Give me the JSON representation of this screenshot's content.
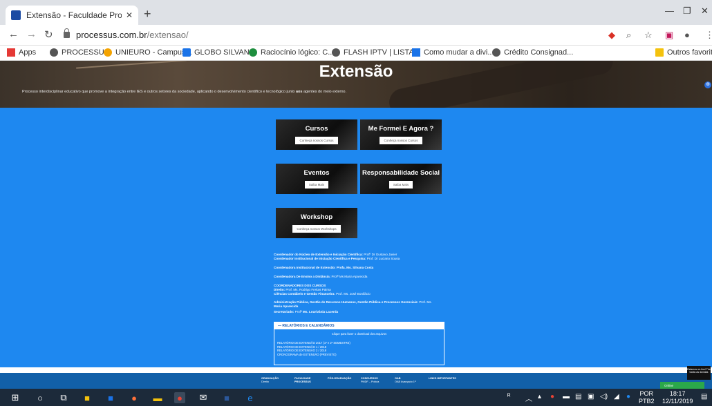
{
  "browser": {
    "tab_title": "Extensão - Faculdade Processus |",
    "tab_close": "✕",
    "new_tab": "+",
    "url_host": "processus.com.br",
    "url_path": "/extensao/",
    "bookmarks": [
      {
        "label": "Apps",
        "color": "#e53935"
      },
      {
        "label": "PROCESSUS",
        "color": "#555555"
      },
      {
        "label": "UNIEURO - Campus...",
        "color": "#f4a300"
      },
      {
        "label": "GLOBO SILVANA",
        "color": "#1a73e8"
      },
      {
        "label": "Raciocínio lógico: C...",
        "color": "#1e8e3e"
      },
      {
        "label": "FLASH IPTV | LISTA...",
        "color": "#555555"
      },
      {
        "label": "Como mudar a divi...",
        "color": "#1a73e8"
      },
      {
        "label": "Crédito Consignad...",
        "color": "#555555"
      },
      {
        "label": "Outros favoritos",
        "color": "#f4c20d"
      }
    ]
  },
  "hero": {
    "title": "Extensão",
    "description_start": "Processo interdisciplinar educativo que promove a integração entre IES e outros setores da sociedade, aplicando o desenvolvimento científico e tecnológico junto ",
    "description_bold": "aos",
    "description_end": " agentes do meio externo."
  },
  "cards": [
    {
      "title": "Cursos",
      "button": "Conheça nossos Cursos"
    },
    {
      "title": "Me Formei E Agora ?",
      "button": "Conheça nossos Cursos"
    },
    {
      "title": "Eventos",
      "button": "Saiba Mais"
    },
    {
      "title": "Responsabilidade Social",
      "button": "Saiba Mais"
    },
    {
      "title": "Workshop",
      "button": "Conheça nossos Workshops"
    }
  ],
  "coordination": {
    "l1_label": "Coordenador do Núcleo de Extensão e Iniciação Científica:",
    "l1_value": " Profº Dr Gustavo Javier",
    "l2_label": "Coordenador Institucional de Iniciação Científica e Pesquisa:",
    "l2_value": " Prof. Dr Luciano Sousa",
    "l3_label": "Coordenadora Institucional de Extensão: Profa. Ms. Silvana Costa",
    "l4_label": "Coordenadora De Ensino a Distância:",
    "l4_value": " Profª Ms Maria Aparecida",
    "courses_heading": "COORDENADORES DOS CURSOS",
    "c1_label": "Direito:",
    "c1_value": " Prof. Ms. Rodrigo Freitas Palma",
    "c2_label": "Ciências Contábeis e Gestão Financeira:",
    "c2_value": " Prof. Ms. José Bonifácio",
    "c3_label": "Administração Pública, Gestão de Recursos Humanos, Gestão Pública e Processos Gerenciais:",
    "c3_value": " Prof. Ms.",
    "c3_cont": "Maria Aparecida",
    "c4_label": "Secretariado:",
    "c4_value": " Profª",
    "c4_bold": "  Ms. Lourivânia Lacerda"
  },
  "reports": {
    "header": "—  RELATÓRIOS E CALENDÁRIOS",
    "subtitle": "Clique para fazer o download dos arquivos",
    "items": [
      "RELATÓRIO DE EXTENSÃO 2017 (1º e 2º SEMESTRE)",
      "RELATÓRIO DE EXTENSÃO 1 / 2018",
      "RELATÓRIO DE EXTENSÃO 2 / 2018",
      "CRONOGRAMA de EXTENSÃO (PREVISTO)"
    ]
  },
  "footer": {
    "columns": [
      {
        "title": "GRADUAÇÃO",
        "sub": "Direito"
      },
      {
        "title": "FACULDADE PROCESSUS",
        "sub": ""
      },
      {
        "title": "PÓS-GRADUAÇÃO",
        "sub": ""
      },
      {
        "title": "CONCURSOS",
        "sub": "PMDF – Polícia"
      },
      {
        "title": "OAB",
        "sub": "OAB Avançado 1ª"
      },
      {
        "title": "LINKS IMPORTANTES",
        "sub": ""
      }
    ],
    "chat": "Estamos on-line! Tire todas as dúvidas",
    "online": "Online"
  },
  "taskbar": {
    "lang": "POR",
    "lang_sub": "PTB2",
    "time": "18:17",
    "date": "12/11/2019"
  }
}
